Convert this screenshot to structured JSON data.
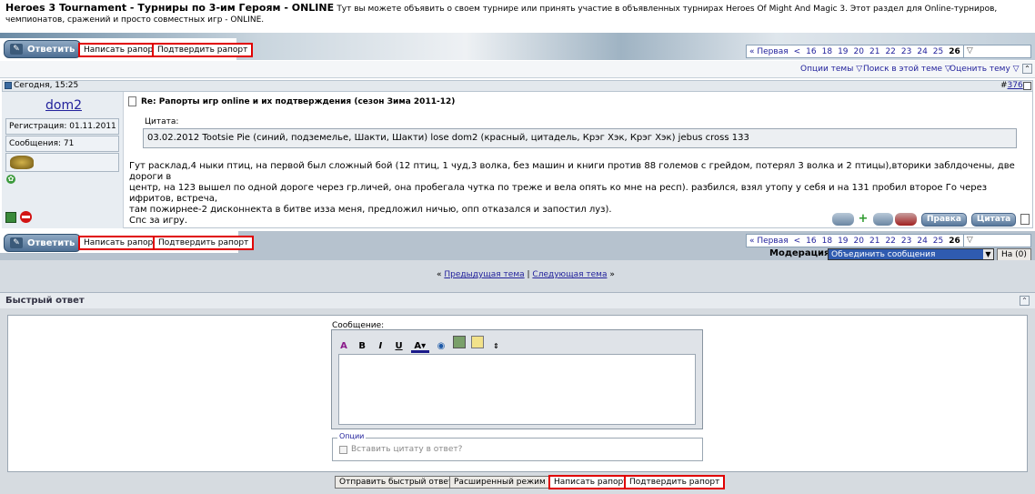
{
  "header": {
    "title": "Heroes 3 Tournament - Турниры по 3-им Героям - ONLINE",
    "description": "Тут вы можете объявить о своем турнире или принять участие в объявленных турнирах Heroes Of Might And Magic 3. Этот раздел для Online-турниров, чемпионатов, сражений и просто совместных игр - ONLINE."
  },
  "actions": {
    "reply_label": "Ответить",
    "write_report_label": "Написать рапорт",
    "confirm_report_label": "Подтвердить рапорт"
  },
  "pager": {
    "first_label": "« Первая",
    "prev_label": "<",
    "pages": [
      "16",
      "18",
      "19",
      "20",
      "21",
      "22",
      "23",
      "24",
      "25"
    ],
    "current": "26"
  },
  "tools": {
    "thread_options": "Опции темы",
    "search_thread": "Поиск в этой теме",
    "rate_thread": "Оценить тему"
  },
  "post": {
    "date": "Сегодня, 15:25",
    "number_prefix": "#",
    "number": "376",
    "username": "dom2",
    "registration": "Регистрация: 01.11.2011",
    "messages": "Сообщения: 71",
    "title": "Re: Рапорты игр online и их подтверждения (сезон Зима 2011-12)",
    "quote_label": "Цитата:",
    "quote_text": "03.02.2012 Tootsie Pie (синий, подземелье, Шакти, Шакти) lose dom2 (красный, цитадель, Крэг Хэк, Крэг Хэк) jebus cross 133",
    "body_line1": "Гут расклад,4 ныки птиц, на первой был сложный бой (12 птиц, 1 чуд,3 волка, без машин и книги против 88 големов с грейдом, потерял 3 волка и 2 птицы),вторики заблдочены, две дороги в",
    "body_line2": "центр, на 123 вышел по одной дороге через гр.личей, она пробегала чутка по треже и вела опять ко мне на респ). разбился, взял утопу у себя и на 131 пробил второе Го через ифритов, встреча,",
    "body_line3": "там пожирнее-2 дисконнекта в битве изза меня, предложил ничью, опп отказался и запостил луз).",
    "body_line4": "Спс за игру.",
    "edit_label": "Правка",
    "quote_btn_label": "Цитата"
  },
  "moderation": {
    "label": "Модерация",
    "selected": "Объединить сообщения",
    "go_label": "На (0)"
  },
  "thread_nav": {
    "prev": "Предыдущая тема",
    "separator": "|",
    "next": "Следующая тема"
  },
  "quick_reply": {
    "title": "Быстрый ответ",
    "message_label": "Сообщение:",
    "options_label": "Опции",
    "quote_checkbox_label": "Вставить цитату в ответ?",
    "send_label": "Отправить быстрый ответ",
    "advanced_label": "Расширенный режим"
  }
}
